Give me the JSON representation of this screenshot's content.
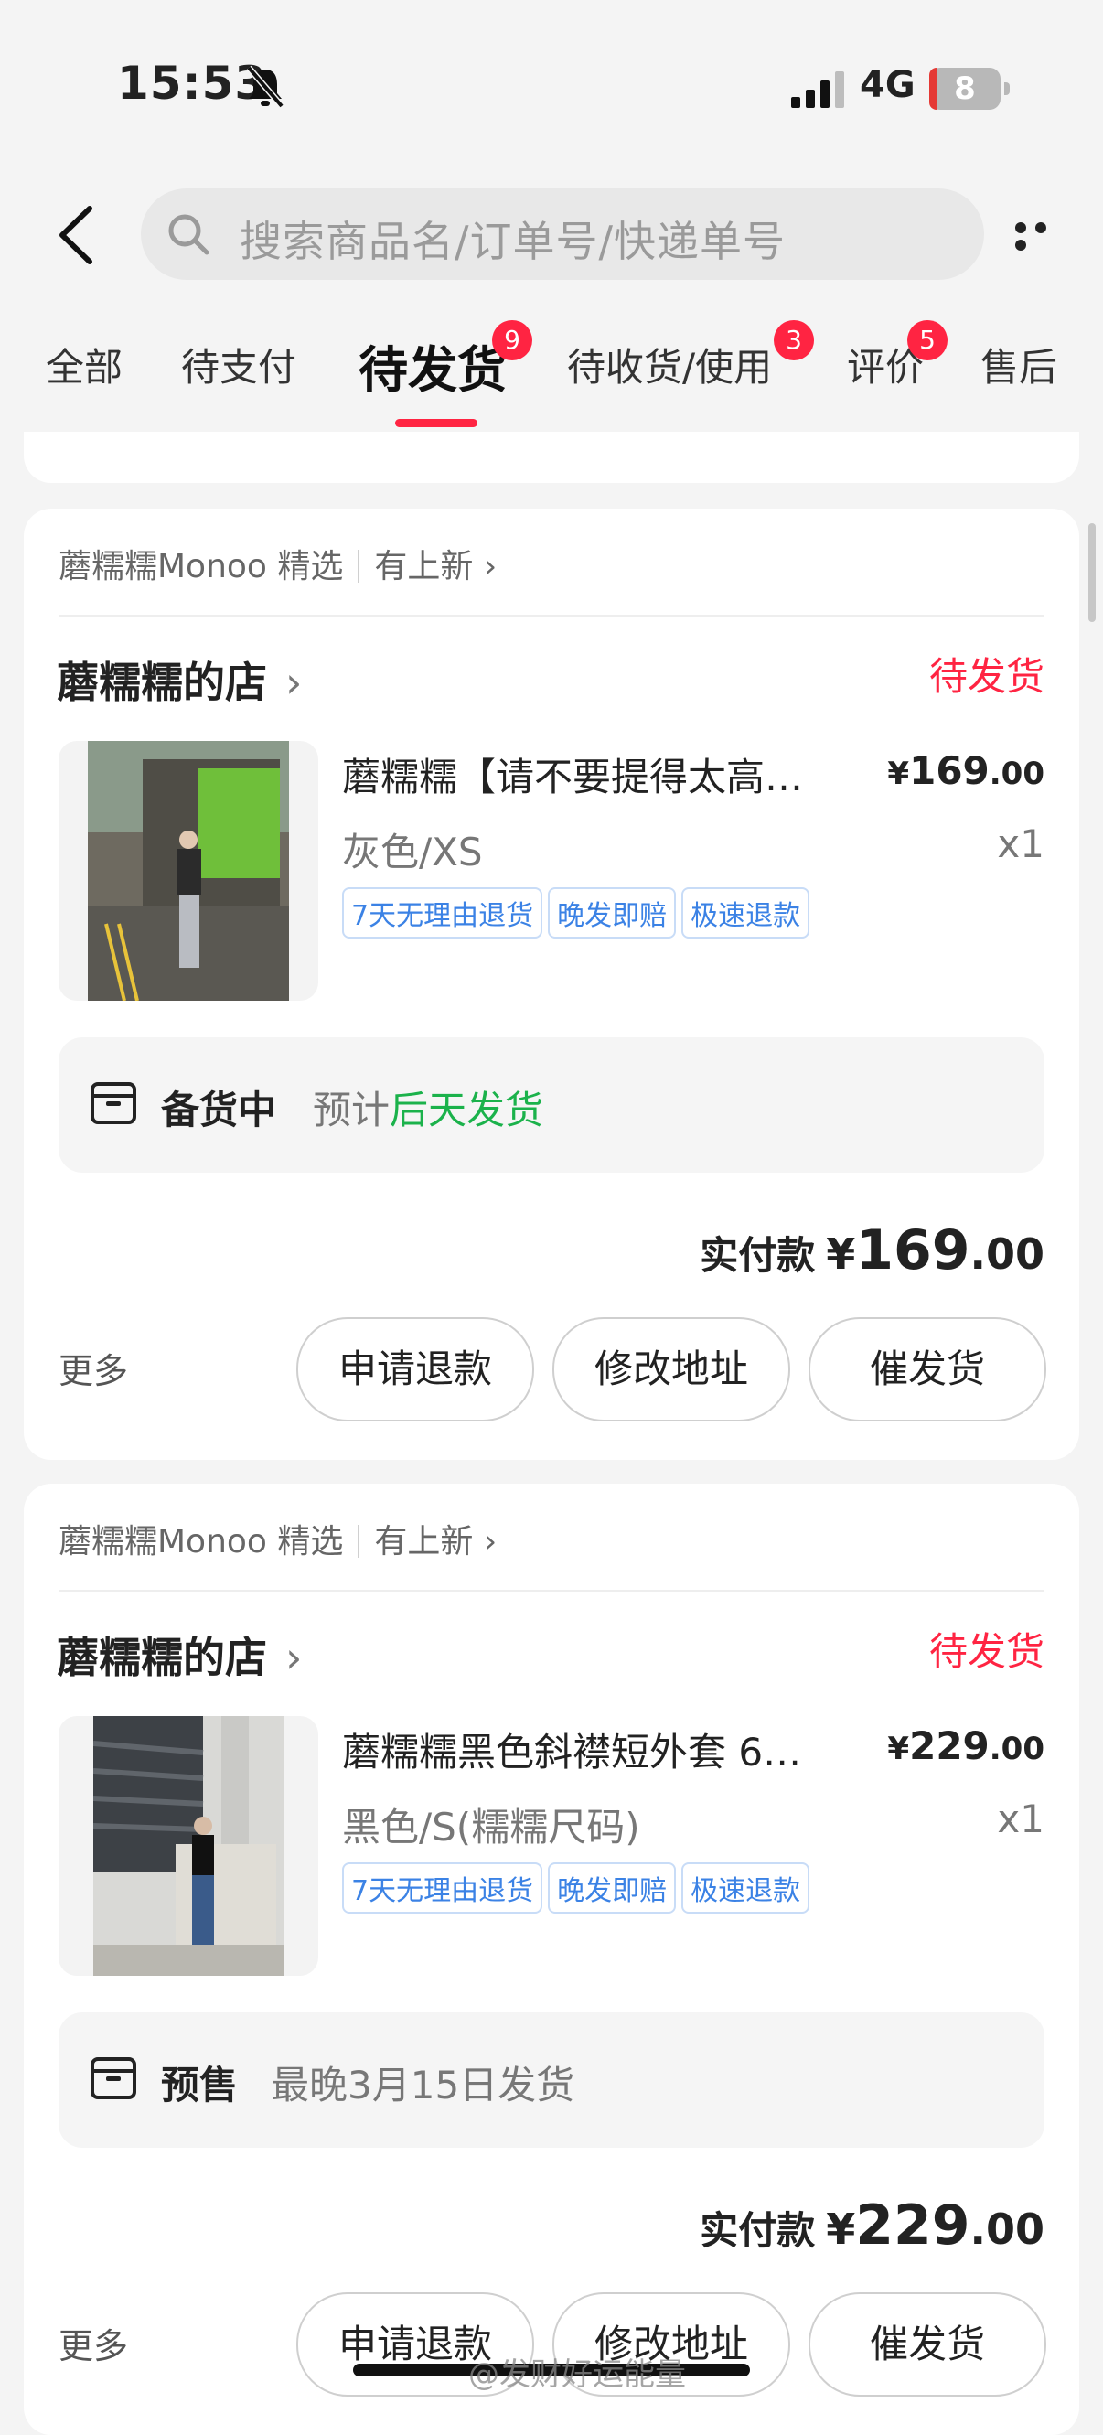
{
  "status_bar": {
    "time": "15:53",
    "network": "4G",
    "battery": "8"
  },
  "search": {
    "placeholder": "搜索商品名/订单号/快递单号"
  },
  "tabs": [
    {
      "label": "全部"
    },
    {
      "label": "待支付"
    },
    {
      "label": "待发货",
      "badge": "9",
      "active": true
    },
    {
      "label": "待收货/使用",
      "badge": "3"
    },
    {
      "label": "评价",
      "badge": "5"
    },
    {
      "label": "售后"
    }
  ],
  "orders": [
    {
      "source": "蘑糯糯Monoo 精选",
      "source_link": "有上新",
      "shop": "蘑糯糯的店",
      "status": "待发货",
      "product_title": "蘑糯糯【请不要提得太高…",
      "price_symbol": "¥",
      "price_int": "169",
      "price_dec": ".00",
      "spec": "灰色/XS",
      "qty": "x1",
      "tags": [
        "7天无理由退货",
        "晚发即赔",
        "极速退款"
      ],
      "ship_status": "备货中",
      "ship_note": "预计",
      "ship_highlight": "后天发货",
      "paid_label": "实付款",
      "paid_symbol": "¥",
      "paid_int": "169",
      "paid_dec": ".00",
      "more": "更多",
      "buttons": [
        "申请退款",
        "修改地址",
        "催发货"
      ]
    },
    {
      "source": "蘑糯糯Monoo 精选",
      "source_link": "有上新",
      "shop": "蘑糯糯的店",
      "status": "待发货",
      "product_title": "蘑糯糯黑色斜襟短外套 6…",
      "price_symbol": "¥",
      "price_int": "229",
      "price_dec": ".00",
      "spec": "黑色/S(糯糯尺码)",
      "qty": "x1",
      "tags": [
        "7天无理由退货",
        "晚发即赔",
        "极速退款"
      ],
      "ship_status": "预售",
      "ship_note": "最晚3月15日发货",
      "paid_label": "实付款",
      "paid_symbol": "¥",
      "paid_int": "229",
      "paid_dec": ".00",
      "more": "更多",
      "buttons": [
        "申请退款",
        "修改地址",
        "催发货"
      ]
    }
  ],
  "watermark": "@发财好运能量",
  "colors": {
    "accent": "#ff2442",
    "ship_green": "#1bb24b",
    "tag_blue": "#3b82e5"
  }
}
